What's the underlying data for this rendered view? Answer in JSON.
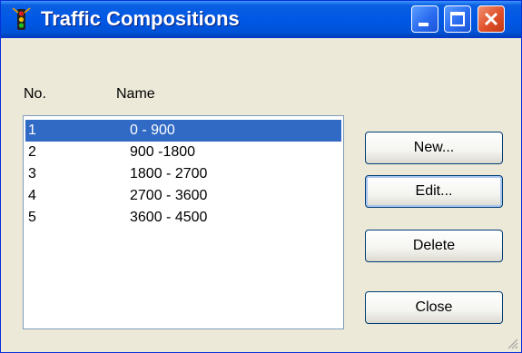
{
  "window": {
    "title": "Traffic Compositions",
    "app_icon": "traffic-light-icon"
  },
  "list": {
    "headers": {
      "no": "No.",
      "name": "Name"
    },
    "rows": [
      {
        "no": "1",
        "name": "0 - 900",
        "selected": true
      },
      {
        "no": "2",
        "name": "900 -1800",
        "selected": false
      },
      {
        "no": "3",
        "name": "1800 - 2700",
        "selected": false
      },
      {
        "no": "4",
        "name": "2700 - 3600",
        "selected": false
      },
      {
        "no": "5",
        "name": "3600 - 4500",
        "selected": false
      }
    ]
  },
  "buttons": {
    "new_label": "New...",
    "edit_label": "Edit...",
    "delete_label": "Delete",
    "close_label": "Close"
  },
  "colors": {
    "titlebar": "#0058e6",
    "selection": "#316ac5",
    "dialog_bg": "#ece9d8"
  }
}
